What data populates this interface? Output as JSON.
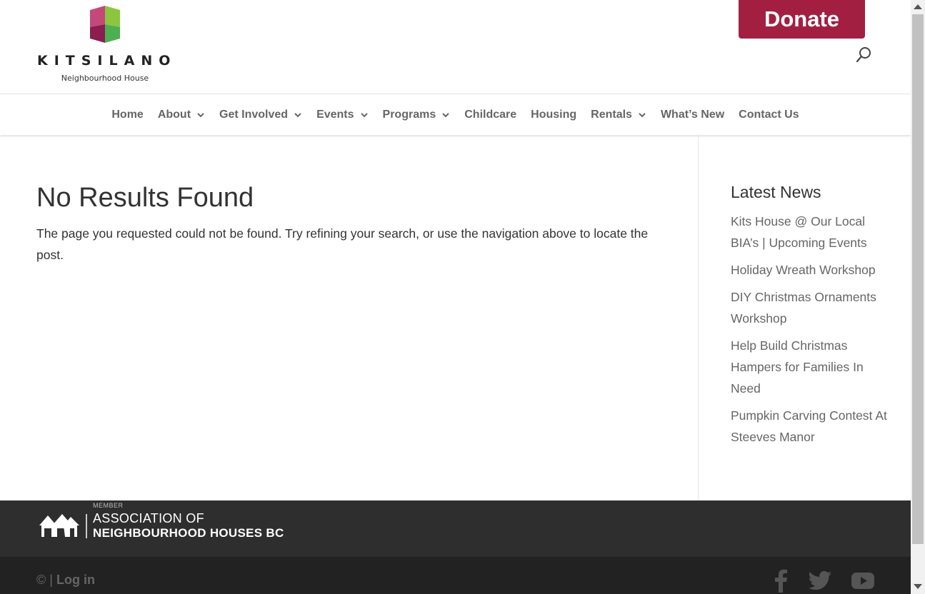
{
  "header": {
    "logo_name": "KITSILANO",
    "logo_sub": "Neighbourhood House",
    "donate_label": "Donate",
    "search_icon": "search-icon"
  },
  "nav": {
    "items": [
      {
        "label": "Home"
      },
      {
        "label": "About",
        "dropdown": true
      },
      {
        "label": "Get Involved",
        "dropdown": true
      },
      {
        "label": "Events",
        "dropdown": true
      },
      {
        "label": "Programs",
        "dropdown": true
      },
      {
        "label": "Childcare"
      },
      {
        "label": "Housing"
      },
      {
        "label": "Rentals",
        "dropdown": true
      },
      {
        "label": "What’s New"
      },
      {
        "label": "Contact Us"
      }
    ]
  },
  "main": {
    "title": "No Results Found",
    "message": "The page you requested could not be found. Try refining your search, or use the navigation above to locate the post."
  },
  "sidebar": {
    "title": "Latest News",
    "news": [
      "Kits House @ Our Local BIA’s | Upcoming Events",
      "Holiday Wreath Workshop",
      "DIY Christmas Ornaments Workshop",
      "Help Build Christmas Hampers for Families In Need",
      "Pumpkin Carving Contest At Steeves Manor"
    ]
  },
  "footer": {
    "member_label": "MEMBER",
    "association_line1": "ASSOCIATION OF",
    "association_line2": "NEIGHBOURHOOD HOUSES BC",
    "copyright": "© |",
    "login_label": "Log in",
    "social": [
      "facebook-icon",
      "twitter-icon",
      "youtube-icon"
    ]
  },
  "colors": {
    "donate": "#a31f42",
    "footer_top": "#2e2e2e",
    "footer_bottom": "#222222",
    "nav_text": "#666666"
  }
}
